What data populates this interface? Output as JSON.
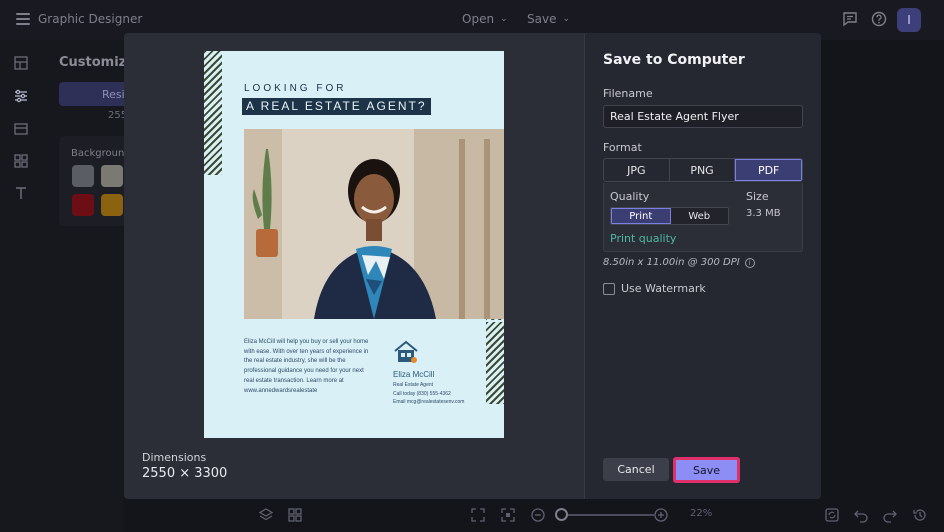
{
  "app": {
    "title": "Graphic Designer",
    "menu_open": "Open",
    "menu_save": "Save",
    "avatar_initial": "I"
  },
  "customize": {
    "title": "Customize",
    "tab_label": "Resi",
    "number_fragment": "255",
    "background_label": "Background"
  },
  "flyer": {
    "kicker": "LOOKING FOR",
    "headline": "A REAL ESTATE AGENT?",
    "body": "Eliza McCill will help you buy or sell your home with ease. With over ten years of experience in the real estate industry, she will be the professional guidance you need for your next real estate transaction. Learn more at www.annedwardsrealestate",
    "contact_name": "Eliza McCill",
    "contact_role": "Real Estate Agent",
    "contact_phone": "Call today (830) 555-4362",
    "contact_email": "Email mcg@realestatesenv.com"
  },
  "dimensions": {
    "label": "Dimensions",
    "value": "2550 × 3300"
  },
  "save_dialog": {
    "title": "Save to Computer",
    "filename_label": "Filename",
    "filename_value": "Real Estate Agent Flyer",
    "format_label": "Format",
    "formats": [
      "JPG",
      "PNG",
      "PDF"
    ],
    "selected_format": "PDF",
    "quality_label": "Quality",
    "quality_options": [
      "Print",
      "Web"
    ],
    "selected_quality": "Print",
    "size_label": "Size",
    "size_value": "3.3 MB",
    "quality_note": "Print quality",
    "dpi_text": "8.50in x 11.00in @ 300 DPI",
    "watermark_label": "Use Watermark",
    "watermark_checked": false,
    "cancel_label": "Cancel",
    "save_label": "Save"
  },
  "zoom": {
    "value": "22%"
  },
  "colors": {
    "accent": "#8c8ef5",
    "selected_border": "#7b7fe0",
    "highlight_border": "#e0306c",
    "print_quality": "#4fb7a4"
  }
}
